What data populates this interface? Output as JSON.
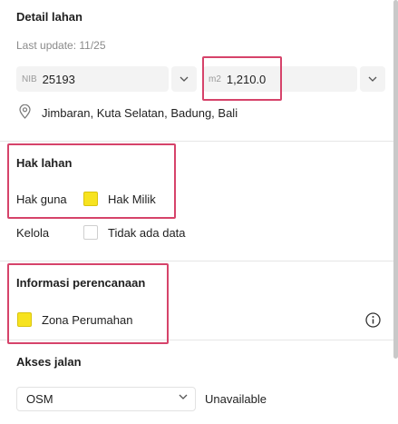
{
  "detail": {
    "title": "Detail lahan",
    "last_update": "Last update: 11/25",
    "nib_prefix": "NIB",
    "nib_value": "25193",
    "area_prefix": "m2",
    "area_value": "1,210.0",
    "location": "Jimbaran, Kuta Selatan, Badung, Bali"
  },
  "hak_lahan": {
    "title": "Hak lahan",
    "rows": [
      {
        "label": "Hak guna",
        "value": "Hak Milik",
        "swatch": "yellow"
      },
      {
        "label": "Kelola",
        "value": "Tidak ada data",
        "swatch": "empty"
      }
    ]
  },
  "perencanaan": {
    "title": "Informasi perencanaan",
    "zone": "Zona Perumahan"
  },
  "akses": {
    "title": "Akses jalan",
    "source": "OSM",
    "status": "Unavailable"
  },
  "icons": {
    "location": "map-pin-icon",
    "info": "info-icon",
    "chevron": "chevron-down-icon"
  },
  "colors": {
    "highlight": "#d6436a",
    "zone_yellow": "#f7e31f"
  }
}
